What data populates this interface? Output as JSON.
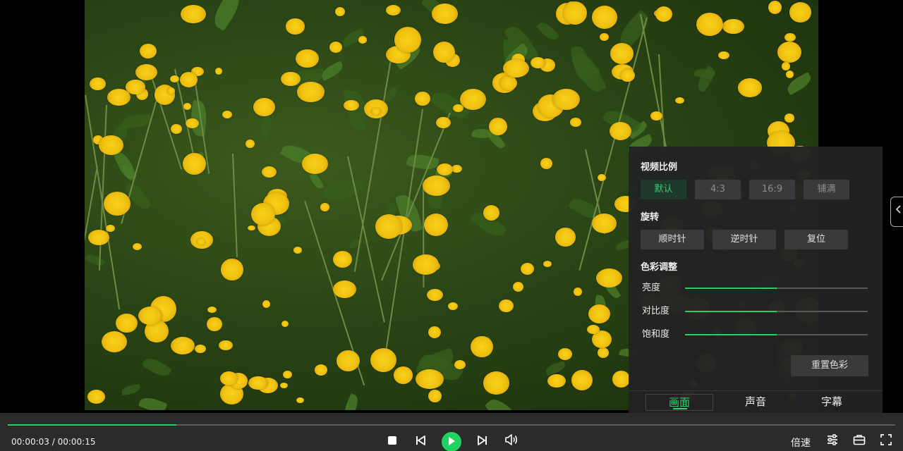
{
  "panel": {
    "ratio": {
      "title": "视频比例",
      "options": [
        "默认",
        "4:3",
        "16:9",
        "铺满"
      ],
      "selected": "默认"
    },
    "rotate": {
      "title": "旋转",
      "buttons": [
        "顺时针",
        "逆时针",
        "复位"
      ]
    },
    "color": {
      "title": "色彩调整",
      "sliders": [
        {
          "label": "亮度",
          "value": 0.5
        },
        {
          "label": "对比度",
          "value": 0.5
        },
        {
          "label": "饱和度",
          "value": 0.5
        }
      ],
      "reset_label": "重置色彩"
    },
    "tabs": [
      "画面",
      "声音",
      "字幕"
    ],
    "active_tab": "画面"
  },
  "playback": {
    "time_display": "00:00:03 / 00:00:15",
    "progress": 0.19,
    "speed_label": "倍速"
  },
  "colors": {
    "accent": "#1fd262",
    "panel_bg": "#222224",
    "bar_bg": "#2b2b2b"
  },
  "icons": {
    "stop": "stop-icon",
    "prev": "skip-previous-icon",
    "play": "play-icon",
    "next": "skip-next-icon",
    "volume": "volume-icon",
    "settings": "sliders-icon",
    "toolbox": "toolbox-icon",
    "fullscreen": "fullscreen-icon",
    "side_toggle": "chevron-left-icon"
  }
}
